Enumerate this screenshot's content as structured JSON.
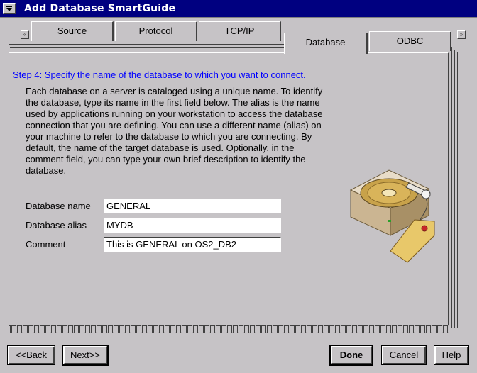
{
  "window": {
    "title": "Add Database SmartGuide",
    "sysmenu_icon": "chevron-down-icon"
  },
  "tabs": [
    {
      "label": "Source",
      "active": false
    },
    {
      "label": "Protocol",
      "active": false
    },
    {
      "label": "TCP/IP",
      "active": false
    },
    {
      "label": "Database",
      "active": true
    },
    {
      "label": "ODBC",
      "active": false
    }
  ],
  "page": {
    "step": "Step 4: Specify the name of the database to which you want to connect.",
    "description": " Each database on a server is cataloged using a unique name. To identify\nthe database, type its name in the first field below.  The alias is the name\nused by applications running on your workstation to access the database\nconnection that you are defining.   You can use a different name (alias) on\nyour machine to refer to the database to which you are connecting.  By\ndefault, the name of the target database is used.   Optionally, in the\ncomment field, you can type your own brief description to identify the\ndatabase.",
    "fields": {
      "db_name_label": "Database name",
      "db_name_value": "GENERAL",
      "db_alias_label": "Database alias",
      "db_alias_value": "MYDB",
      "comment_label": "Comment",
      "comment_value": "This is GENERAL on OS2_DB2"
    }
  },
  "buttons": {
    "back": "<<Back",
    "next": "Next>>",
    "done": "Done",
    "cancel": "Cancel",
    "help": "Help"
  },
  "colors": {
    "titlebar": "#000080",
    "step_text": "#0000ff",
    "face": "#c6c3c6"
  }
}
